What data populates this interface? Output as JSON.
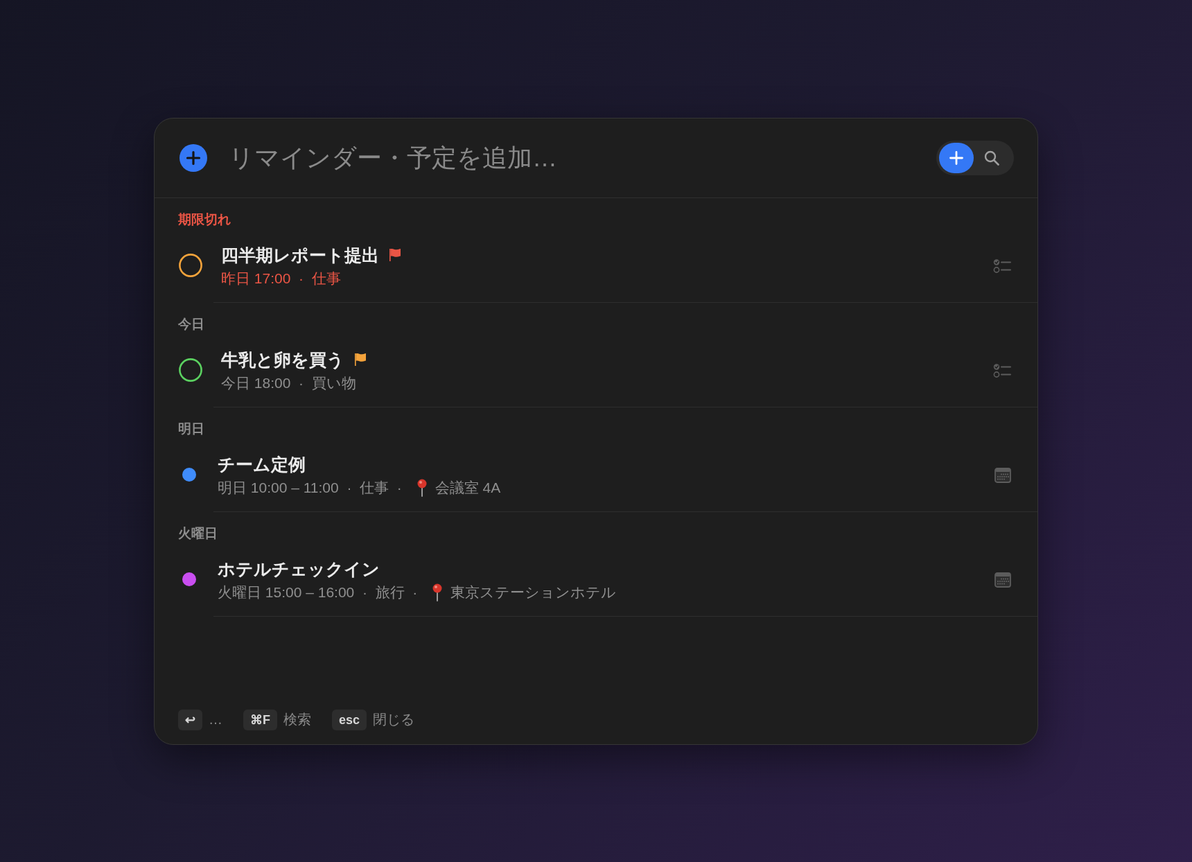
{
  "composer": {
    "placeholder": "リマインダー・予定を追加…"
  },
  "sections": [
    {
      "heading": "期限切れ",
      "overdue": true,
      "items": [
        {
          "kind": "reminder",
          "title": "四半期レポート提出",
          "color": "#f4a33b",
          "completed": false,
          "flagged": true,
          "meta": "昨日 17:00  ·  仕事"
        }
      ]
    },
    {
      "heading": "今日",
      "overdue": false,
      "items": [
        {
          "kind": "reminder",
          "title": "牛乳と卵を買う",
          "color": "#5bd160",
          "completed": false,
          "flagged": true,
          "meta": "今日 18:00  ·  買い物"
        }
      ]
    },
    {
      "heading": "明日",
      "overdue": false,
      "items": [
        {
          "kind": "event",
          "title": "チーム定例",
          "color": "#3f8cfb",
          "flagged": false,
          "meta": "明日 10:00 – 11:00  ·  仕事  ·",
          "location": "会議室 4A"
        }
      ]
    },
    {
      "heading": "火曜日",
      "overdue": false,
      "items": [
        {
          "kind": "event",
          "title": "ホテルチェックイン",
          "color": "#c94ef0",
          "flagged": false,
          "meta": "火曜日 15:00 – 16:00  ·  旅行  ·",
          "location": "東京ステーションホテル"
        }
      ]
    }
  ],
  "shortcuts": [
    {
      "key": "↩",
      "label": "…"
    },
    {
      "key": "⌘F",
      "label": "検索"
    },
    {
      "key": "esc",
      "label": "閉じる"
    }
  ]
}
